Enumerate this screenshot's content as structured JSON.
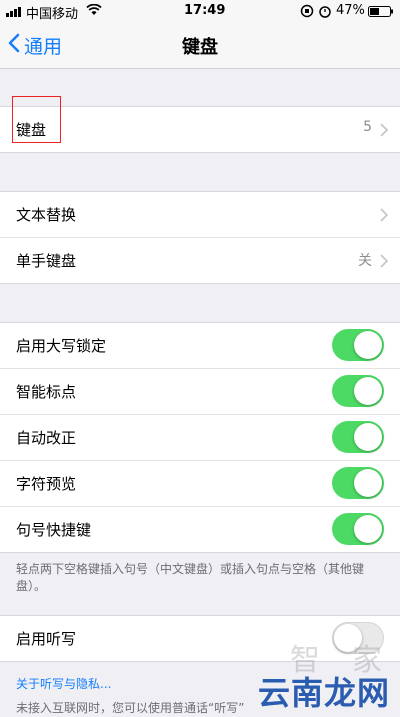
{
  "status": {
    "carrier": "中国移动",
    "time": "17:49",
    "battery": "47%",
    "icons": [
      "signal-icon",
      "wifi-icon",
      "lock-rotation-icon",
      "alarm-icon",
      "battery-icon"
    ]
  },
  "nav": {
    "back_label": "通用",
    "title": "键盘"
  },
  "keyboards": {
    "label": "键盘",
    "value": "5"
  },
  "group2": [
    {
      "label": "文本替换",
      "value": ""
    },
    {
      "label": "单手键盘",
      "value": "关"
    }
  ],
  "toggles": [
    {
      "label": "启用大写锁定",
      "on": true
    },
    {
      "label": "智能标点",
      "on": true
    },
    {
      "label": "自动改正",
      "on": true
    },
    {
      "label": "字符预览",
      "on": true
    },
    {
      "label": "句号快捷键",
      "on": true
    }
  ],
  "period_note": "轻点两下空格键插入句号（中文键盘）或插入句点与空格（其他键盘）。",
  "dictation": {
    "label": "启用听写",
    "on": false
  },
  "privacy_link": "关于听写与隐私...",
  "bottom_note": "未接入互联网时，您可以使用普通话“听写”",
  "watermark": {
    "zhi": "智",
    "jia": "家",
    "site": "云南龙网"
  },
  "colors": {
    "accent": "#157efb",
    "switch_on": "#4cd964",
    "highlight": "#e22222"
  }
}
